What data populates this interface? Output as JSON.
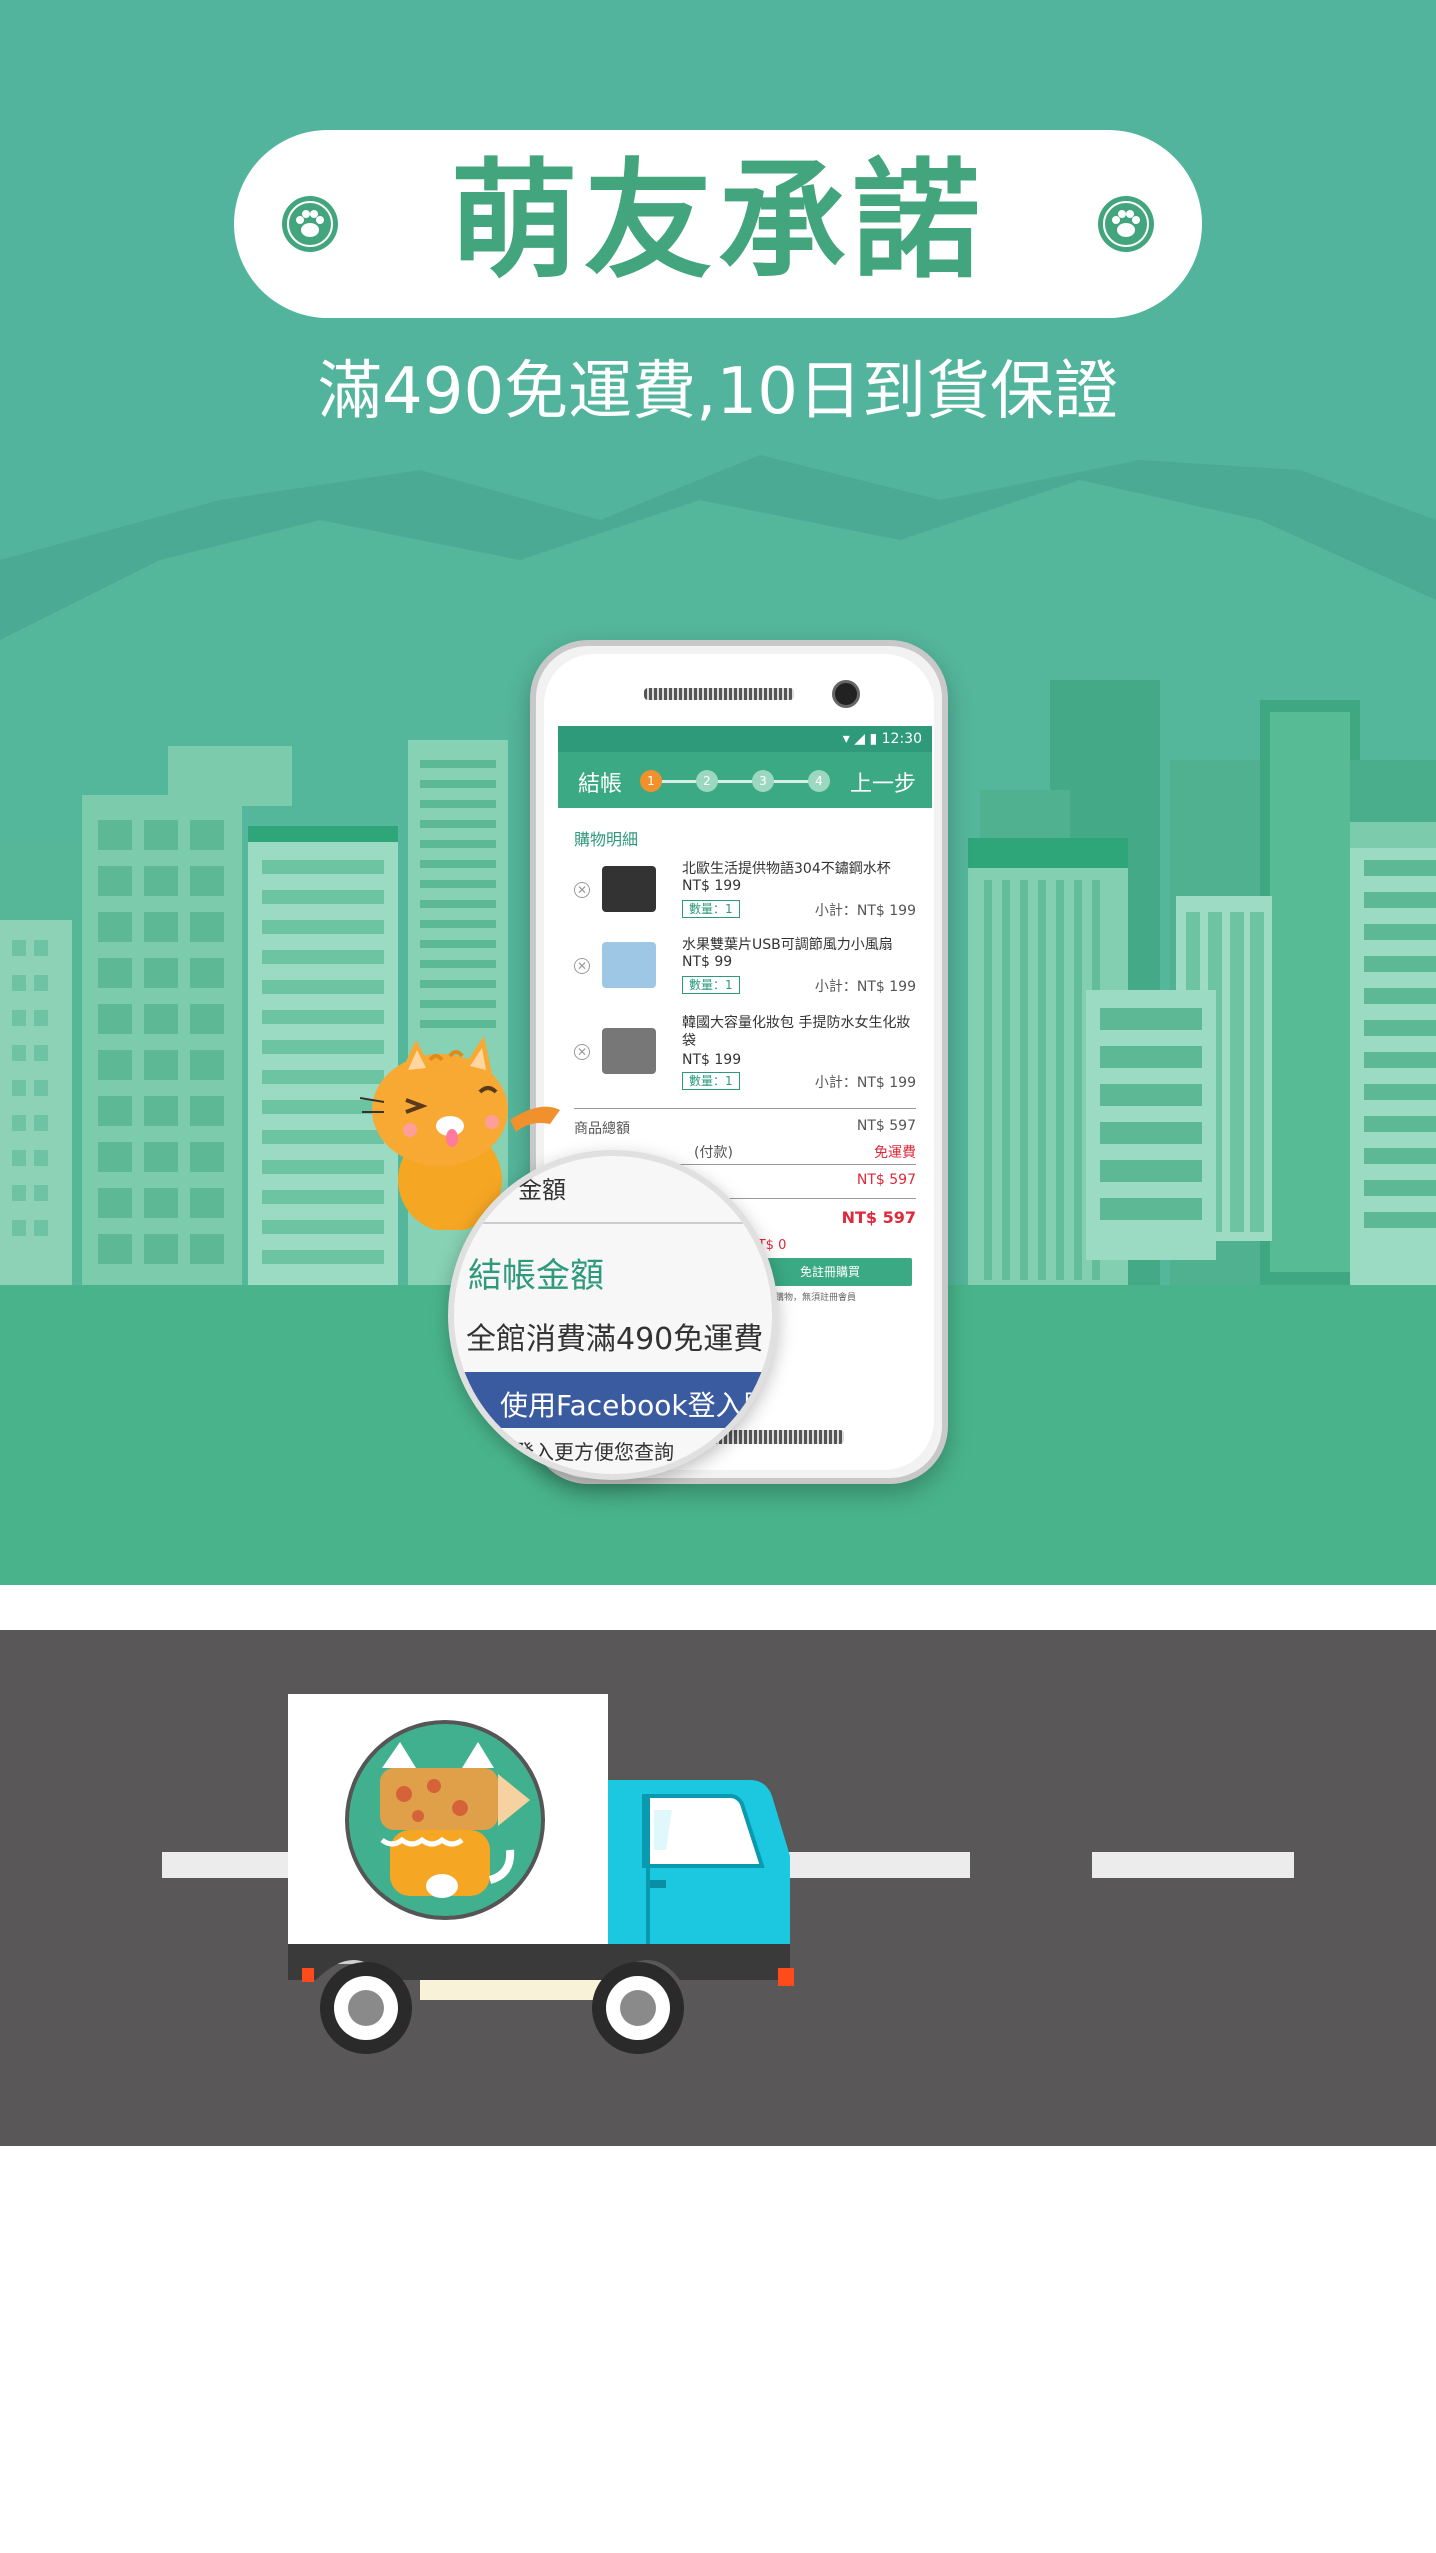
{
  "header": {
    "title": "萌友承諾",
    "subtitle": "滿490免運費,10日到貨保證"
  },
  "phone": {
    "status_time": "12:30",
    "app_bar": {
      "title": "結帳",
      "back_label": "上一步",
      "steps": [
        "1",
        "2",
        "3",
        "4"
      ]
    },
    "cart": {
      "section_label": "購物明細",
      "items": [
        {
          "name": "北歐生活提供物語304不鏽鋼水杯",
          "price": "NT$ 199",
          "qty": "數量：1",
          "subtotal": "小計：NT$ 199"
        },
        {
          "name": "水果雙葉片USB可調節風力小風扇",
          "price": "NT$ 99",
          "qty": "數量：1",
          "subtotal": "小計：NT$ 199"
        },
        {
          "name": "韓國大容量化妝包 手提防水女生化妝袋",
          "price": "NT$ 199",
          "qty": "數量：1",
          "subtotal": "小計：NT$ 199"
        }
      ],
      "product_total_label": "商品總額",
      "product_total_value": "NT$ 597",
      "shipping_label": "(付款)",
      "shipping_value": "免運費",
      "grand_value": "NT$ 597",
      "checkout_value": "NT$ 597",
      "discount_value": "NT$ 0",
      "checkout_button": "免註冊購買",
      "note": "一次性購物，無須註冊會員"
    }
  },
  "magnifier": {
    "line1": "金額",
    "checkout_label": "結帳金額",
    "promo": "全館消費滿490免運費",
    "facebook_button": "使用Facebook登入購",
    "facebook_sub": "登入更方便您查詢"
  },
  "colors": {
    "teal_bg": "#52b49c",
    "title_green": "#42a57e",
    "road": "#595757",
    "truck_cab": "#1cc8e0",
    "accent_orange": "#f0912e",
    "price_red": "#e0283a",
    "facebook_blue": "#3b5ba0"
  },
  "icons": {
    "paw_left": "paw-icon",
    "paw_right": "paw-icon",
    "cat_mascot": "cat-mascot-icon",
    "truck": "delivery-truck-icon",
    "truck_logo": "cat-pencil-logo-icon"
  }
}
